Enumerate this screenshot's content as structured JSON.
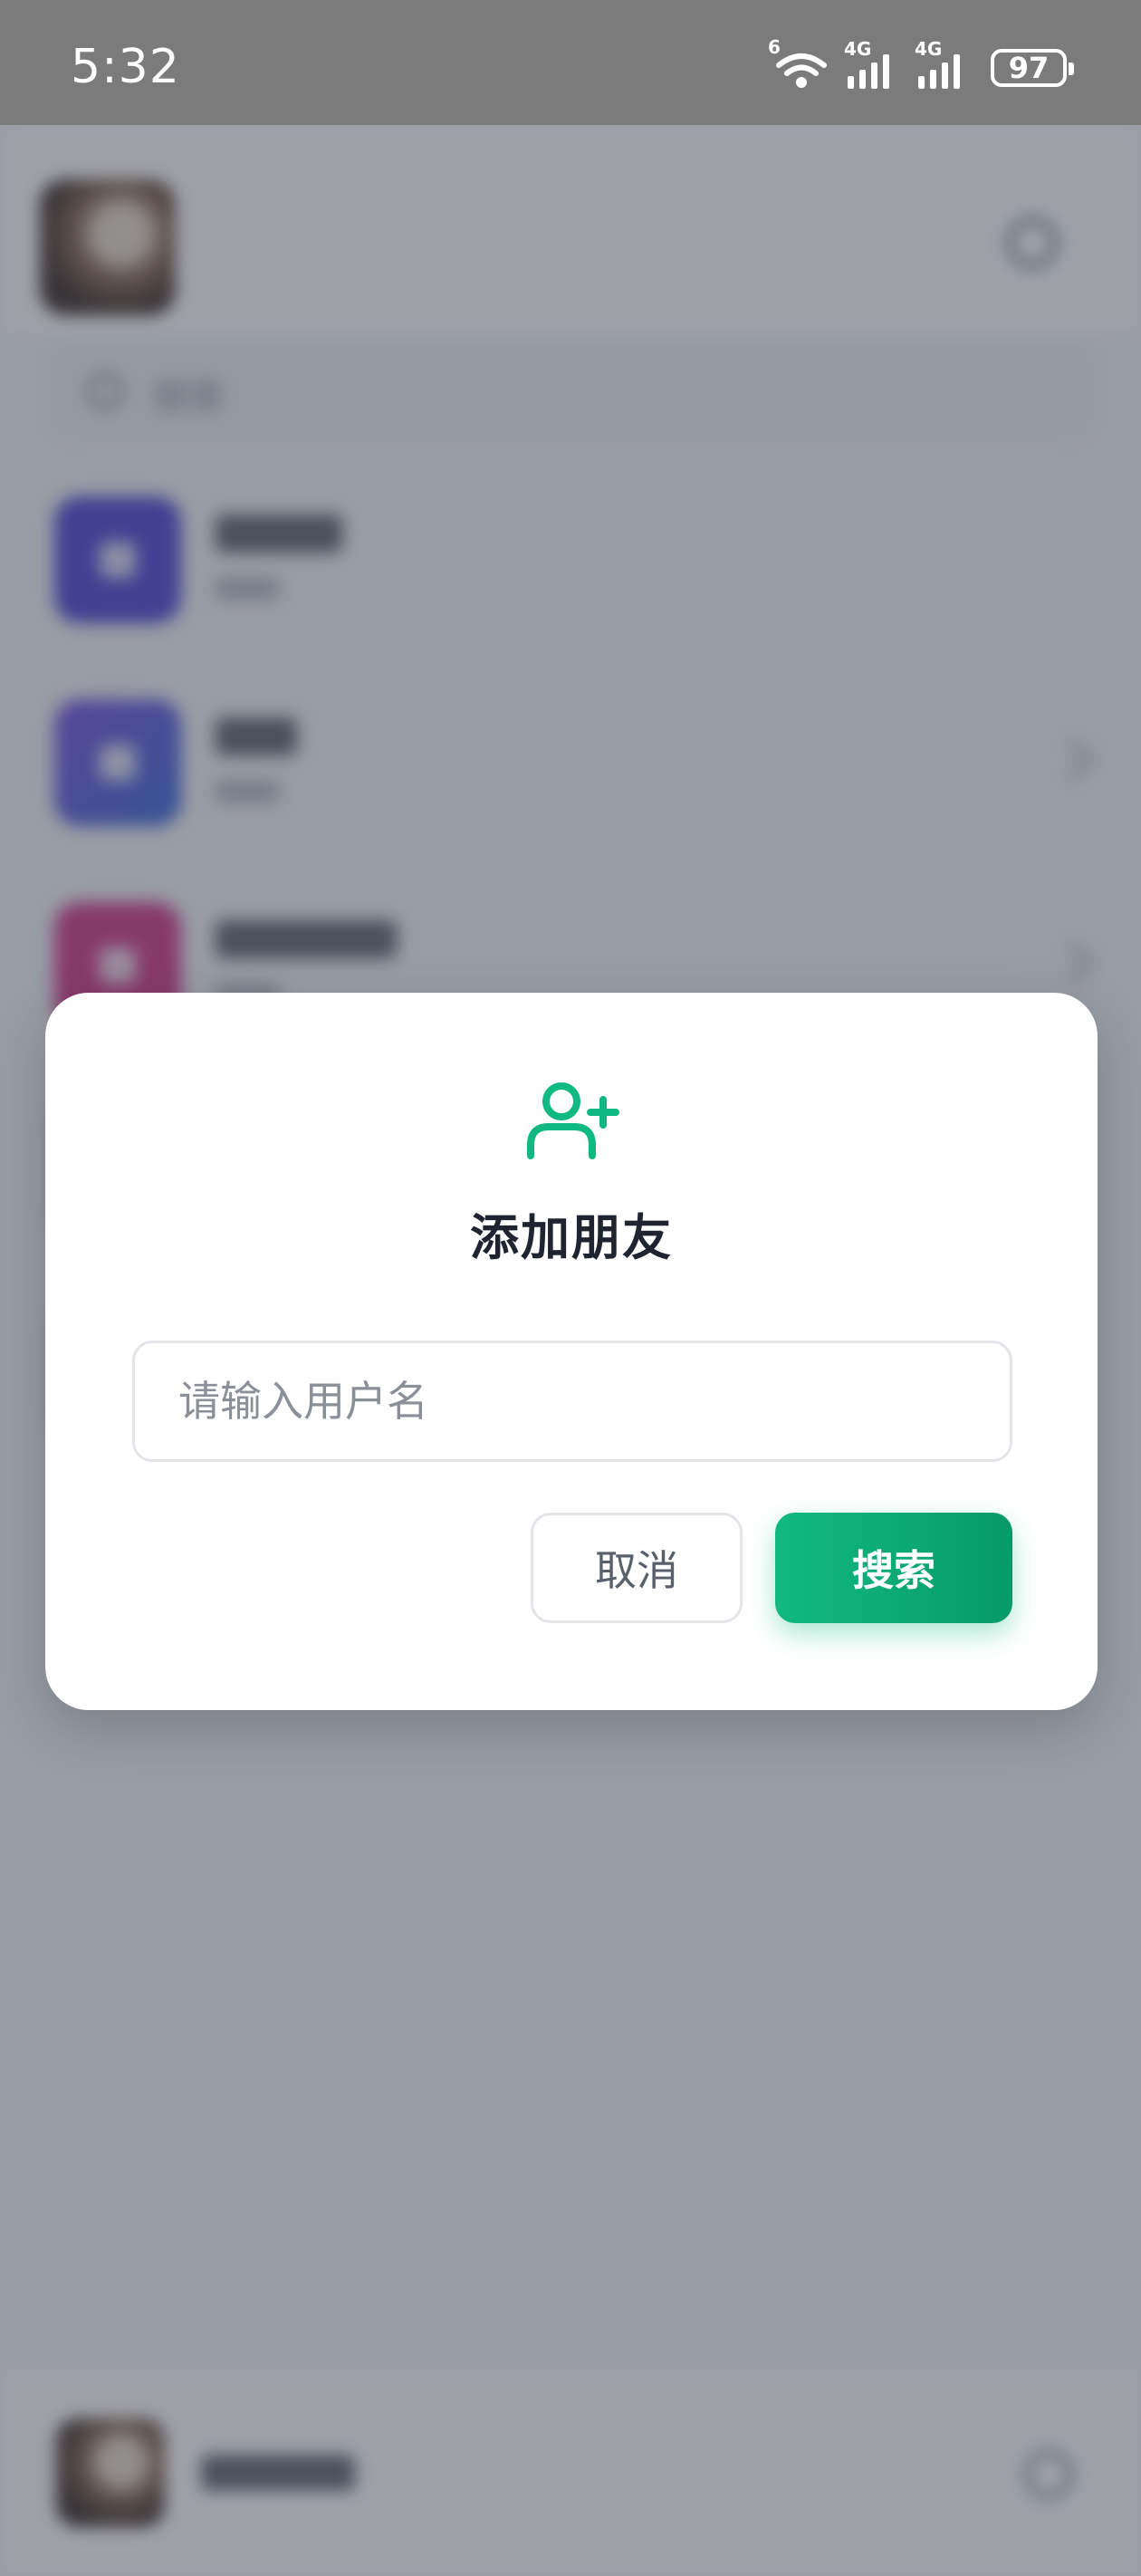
{
  "status_bar": {
    "time": "5:32",
    "wifi_badge": "6",
    "signal_1_label": "4G",
    "signal_2_label": "4G",
    "battery": "97"
  },
  "background_app": {
    "search_placeholder": "搜索"
  },
  "dialog": {
    "icon": "user-plus-icon",
    "title": "添加朋友",
    "input_placeholder": "请输入用户名",
    "input_value": "",
    "cancel_label": "取消",
    "search_label": "搜索"
  },
  "colors": {
    "accent": "#10b981",
    "accent_dark": "#079a68",
    "title_text": "#1f2430",
    "overlay": "#343a4a"
  }
}
